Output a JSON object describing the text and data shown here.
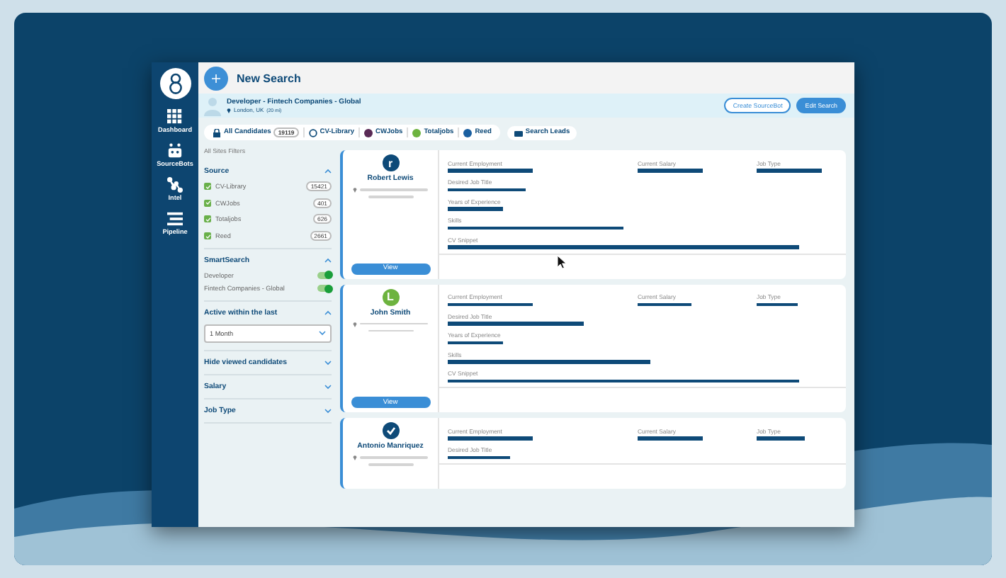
{
  "nav": [
    {
      "label": "Dashboard",
      "kind": "grid"
    },
    {
      "label": "SourceBots",
      "kind": "robot"
    },
    {
      "label": "Intel",
      "kind": "network"
    },
    {
      "label": "Pipeline",
      "kind": "lines"
    }
  ],
  "header": {
    "title": "New Search"
  },
  "search": {
    "title": "Developer - Fintech Companies - Global",
    "location": "London, UK",
    "radius": "(20 mi)"
  },
  "actions": [
    {
      "label": "Create SourceBot",
      "kind": "outline"
    },
    {
      "label": "Edit Search",
      "kind": "filled"
    }
  ],
  "sources": [
    {
      "label": "All Candidates",
      "count": "19119",
      "kind": "lock"
    },
    {
      "label": "CV-Library",
      "kind": "ring"
    },
    {
      "label": "CWJobs",
      "kind": "dot"
    },
    {
      "label": "Totaljobs",
      "kind": "green"
    },
    {
      "label": "Reed",
      "kind": "blue"
    }
  ],
  "leads": {
    "label": "Search Leads"
  },
  "filters": {
    "title": "All Sites Filters",
    "sections": [
      {
        "title": "Source",
        "expanded": true,
        "kind": "checks",
        "items": [
          {
            "label": "CV-Library",
            "count": "15421",
            "checked": true
          },
          {
            "label": "CWJobs",
            "count": "401",
            "checked": true
          },
          {
            "label": "Totaljobs",
            "count": "626",
            "checked": true
          },
          {
            "label": "Reed",
            "count": "2661",
            "checked": true
          }
        ]
      },
      {
        "title": "SmartSearch",
        "expanded": true,
        "kind": "toggles",
        "items": [
          {
            "label": "Developer",
            "on": true
          },
          {
            "label": "Fintech Companies - Global",
            "on": true
          }
        ]
      },
      {
        "title": "Active within the last",
        "expanded": true,
        "kind": "select",
        "value": "1 Month"
      },
      {
        "title": "Hide viewed candidates",
        "expanded": false
      },
      {
        "title": "Salary",
        "expanded": false
      },
      {
        "title": "Job Type",
        "expanded": false
      }
    ]
  },
  "candidates": [
    {
      "name": "Robert Lewis",
      "avatar": {
        "kind": "letter",
        "initial": "r",
        "color": "#0e4a78"
      },
      "view": "View",
      "fields": [
        "Current Employment",
        "Current Salary",
        "Job Type",
        "Desired Job Title",
        "Years of Experience",
        "Skills",
        "CV Snippet"
      ]
    },
    {
      "name": "John Smith",
      "avatar": {
        "kind": "letter",
        "initial": "L",
        "color": "#6db33f"
      },
      "view": "View",
      "fields": [
        "Current Employment",
        "Current Salary",
        "Job Type",
        "Desired Job Title",
        "Years of Experience",
        "Skills",
        "CV Snippet"
      ]
    },
    {
      "name": "Antonio Manriquez",
      "avatar": {
        "kind": "badge",
        "color": "#0e4a78"
      },
      "fields": [
        "Current Employment",
        "Current Salary",
        "Job Type",
        "Desired Job Title"
      ]
    }
  ]
}
